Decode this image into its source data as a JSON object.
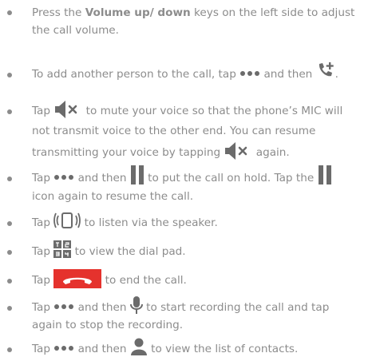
{
  "items": [
    {
      "id": "volume",
      "lines": [
        {
          "pre": "Press the ",
          "bold": "Volume up/ down",
          "post": " keys on the left side to adjust"
        },
        {
          "text": "the call volume."
        }
      ]
    },
    {
      "id": "add-call",
      "parts": {
        "a": "To add another person to the call, tap ",
        "b": " and then ",
        "c": "."
      }
    },
    {
      "id": "mute",
      "lines": [
        {
          "a": "Tap ",
          "b": " to mute your voice so that the phone’s MIC will"
        },
        {
          "text": "not transmit voice to the other end. You can resume"
        },
        {
          "a": "transmitting your voice by tapping ",
          "b": " again."
        }
      ]
    },
    {
      "id": "hold",
      "lines": [
        {
          "a": "Tap ",
          "b": " and then ",
          "c": " to put the call on hold. Tap the "
        },
        {
          "text": "icon again to resume the call."
        }
      ]
    },
    {
      "id": "speaker",
      "parts": {
        "a": "Tap ",
        "b": " to listen via the speaker."
      }
    },
    {
      "id": "dialpad",
      "parts": {
        "a": "Tap ",
        "b": " to view the dial pad."
      }
    },
    {
      "id": "end",
      "parts": {
        "a": "Tap ",
        "b": " to end the call."
      }
    },
    {
      "id": "record",
      "lines": [
        {
          "a": "Tap ",
          "b": " and then ",
          "c": " to start recording the call and tap"
        },
        {
          "text": "again to stop the recording."
        }
      ]
    },
    {
      "id": "contacts",
      "parts": {
        "a": "Tap ",
        "b": " and then ",
        "c": " to view the list of contacts."
      }
    }
  ],
  "colors": {
    "text": "#8c8c8c",
    "icon": "#6b6b6b",
    "end_call": "#e5322d"
  },
  "icons": [
    "more-dots-icon",
    "add-call-icon",
    "mute-icon",
    "pause-icon",
    "speaker-icon",
    "dialpad-icon",
    "end-call-icon",
    "microphone-icon",
    "contact-icon"
  ]
}
